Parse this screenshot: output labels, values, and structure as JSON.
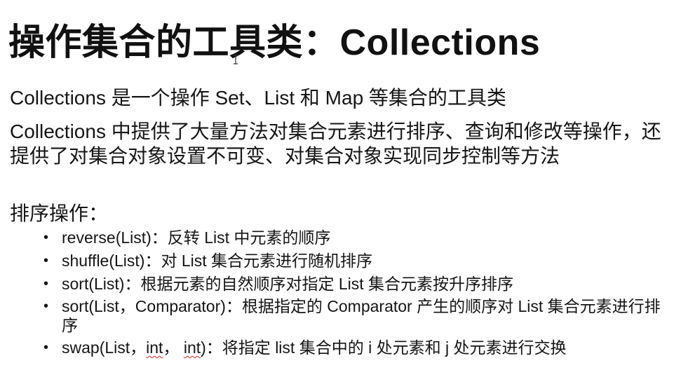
{
  "slide": {
    "title": "操作集合的工具类：Collections",
    "intro_1": "Collections 是一个操作 Set、List 和 Map 等集合的工具类",
    "intro_2": "Collections 中提供了大量方法对集合元素进行排序、查询和修改等操作，还提供了对集合对象设置不可变、对集合对象实现同步控制等方法",
    "section_heading": "排序操作：",
    "bullet_marker": "•",
    "bullets": [
      "reverse(List)：反转 List 中元素的顺序",
      "shuffle(List)：对 List 集合元素进行随机排序",
      "sort(List)：根据元素的自然顺序对指定 List 集合元素按升序排序",
      "sort(List，Comparator)：根据指定的 Comparator 产生的顺序对 List 集合元素进行排序"
    ],
    "swap_bullet": {
      "prefix": "swap(List，",
      "arg1": "int",
      "sep": "， ",
      "arg2": "int",
      "suffix": ")：将指定 list 集合中的 i 处元素和 j 处元素进行交换"
    }
  }
}
